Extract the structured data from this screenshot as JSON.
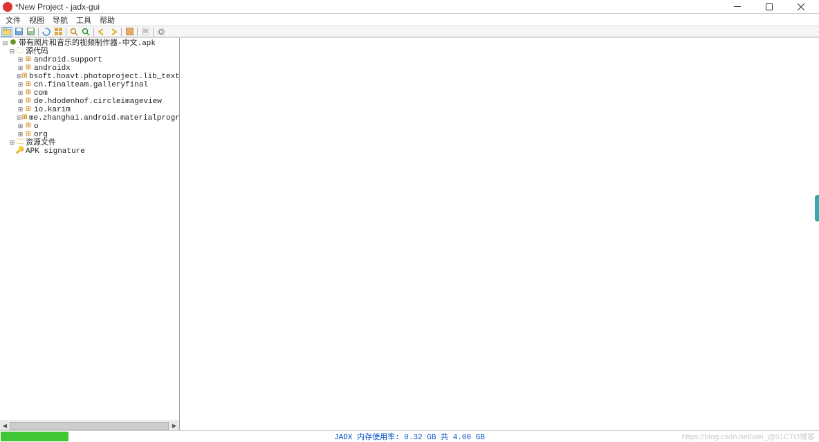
{
  "window": {
    "title": "*New Project - jadx-gui"
  },
  "menu": {
    "file": "文件",
    "view": "视图",
    "nav": "导航",
    "tools": "工具",
    "help": "帮助"
  },
  "tree": {
    "root": "带有照片和音乐的视频制作器-中文.apk",
    "source": "源代码",
    "packages": [
      "android.support",
      "androidx",
      "bsoft.hoavt.photoproject.lib_textcollage.custo",
      "cn.finalteam.galleryfinal",
      "com",
      "de.hdodenhof.circleimageview",
      "io.karim",
      "me.zhanghai.android.materialprogressbar",
      "o",
      "org"
    ],
    "resources": "资源文件",
    "signature": "APK signature"
  },
  "status": {
    "text": "JADX 内存使用率: 0.32 GB 共 4.00 GB",
    "watermark": "https://blog.csdn.net/wei_@51CTO博客"
  }
}
